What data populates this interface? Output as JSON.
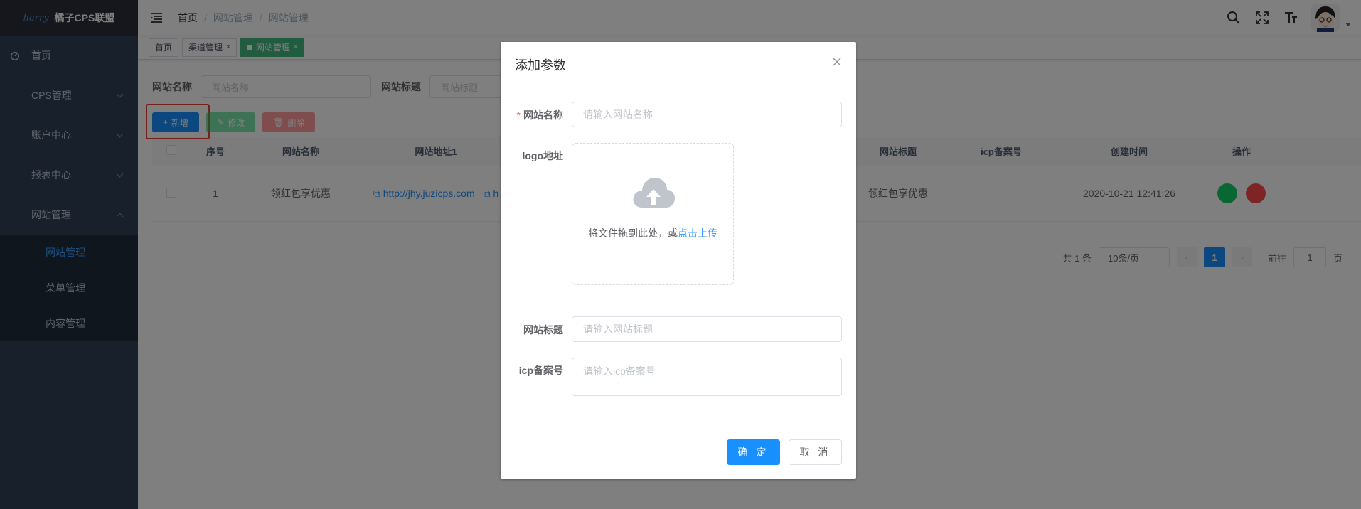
{
  "sidebar": {
    "brand": "harry",
    "title": "橘子CPS联盟",
    "items": [
      {
        "label": "首页"
      },
      {
        "label": "CPS管理"
      },
      {
        "label": "账户中心"
      },
      {
        "label": "报表中心"
      },
      {
        "label": "网站管理"
      }
    ],
    "subitems": [
      {
        "label": "网站管理"
      },
      {
        "label": "菜单管理"
      },
      {
        "label": "内容管理"
      }
    ]
  },
  "breadcrumb": [
    "首页",
    "网站管理",
    "网站管理"
  ],
  "breadcrumb_sep": "/",
  "tags": [
    {
      "label": "首页"
    },
    {
      "label": "渠道管理",
      "close": "×"
    },
    {
      "label": "网站管理",
      "close": "×"
    }
  ],
  "search": {
    "name_label": "网站名称",
    "name_placeholder": "网站名称",
    "title_label": "网站标题",
    "title_placeholder": "网站标题"
  },
  "toolbar": {
    "add": "新增",
    "edit": "修改",
    "delete": "删除"
  },
  "table": {
    "headers": [
      "序号",
      "网站名称",
      "网站地址1",
      "网站标题",
      "icp备案号",
      "创建时间",
      "操作"
    ],
    "rows": [
      {
        "index": "1",
        "name": "领红包享优惠",
        "url1": "http://jhy.juzicps.com",
        "url2": "h",
        "title": "领红包享优惠",
        "icp": "",
        "created": "2020-10-21 12:41:26"
      }
    ]
  },
  "pager": {
    "total": "共 1 条",
    "page_size": "10条/页",
    "current": "1",
    "goto_label": "前往",
    "goto_value": "1",
    "page_unit": "页"
  },
  "dialog": {
    "title": "添加参数",
    "required_mark": "*",
    "name_label": "网站名称",
    "name_placeholder": "请输入网站名称",
    "logo_label": "logo地址",
    "upload_text": "将文件拖到此处，或",
    "upload_link": "点击上传",
    "title_label": "网站标题",
    "title_placeholder": "请输入网站标题",
    "icp_label": "icp备案号",
    "icp_placeholder": "请输入icp备案号",
    "confirm": "确 定",
    "cancel": "取 消"
  },
  "colors": {
    "primary": "#1890ff",
    "sidebar_bg": "#304156",
    "success": "#13ce66",
    "danger": "#ff4949"
  }
}
